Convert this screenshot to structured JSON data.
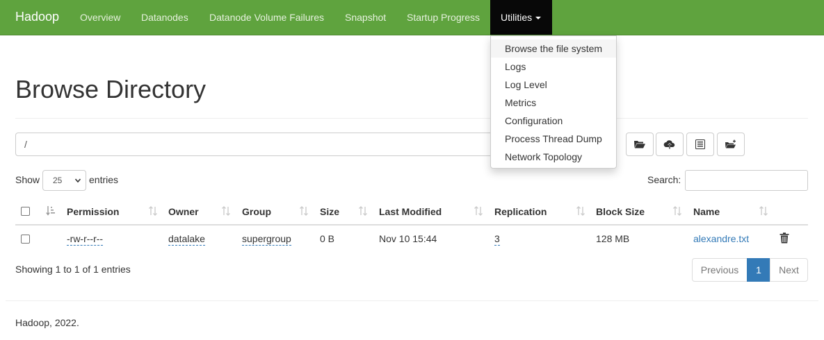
{
  "navbar": {
    "brand": "Hadoop",
    "items": [
      {
        "label": "Overview"
      },
      {
        "label": "Datanodes"
      },
      {
        "label": "Datanode Volume Failures"
      },
      {
        "label": "Snapshot"
      },
      {
        "label": "Startup Progress"
      },
      {
        "label": "Utilities"
      }
    ],
    "color": "#5fa33e"
  },
  "utilities_menu": {
    "items": [
      {
        "label": "Browse the file system"
      },
      {
        "label": "Logs"
      },
      {
        "label": "Log Level"
      },
      {
        "label": "Metrics"
      },
      {
        "label": "Configuration"
      },
      {
        "label": "Process Thread Dump"
      },
      {
        "label": "Network Topology"
      }
    ]
  },
  "page": {
    "title": "Browse Directory",
    "path_value": "/"
  },
  "toolbar": {
    "icons": [
      "folder-open-icon",
      "cloud-upload-icon",
      "list-alt-icon",
      "new-folder-icon"
    ]
  },
  "table_controls": {
    "show_label": "Show",
    "page_size": "25",
    "entries_label": "entries",
    "search_label": "Search:",
    "search_value": ""
  },
  "table": {
    "columns": [
      "Permission",
      "Owner",
      "Group",
      "Size",
      "Last Modified",
      "Replication",
      "Block Size",
      "Name"
    ],
    "rows": [
      {
        "permission": "-rw-r--r--",
        "owner": "datalake",
        "group": "supergroup",
        "size": "0 B",
        "last_modified": "Nov 10 15:44",
        "replication": "3",
        "block_size": "128 MB",
        "name": "alexandre.txt"
      }
    ]
  },
  "pagination": {
    "summary": "Showing 1 to 1 of 1 entries",
    "previous": "Previous",
    "current": "1",
    "next": "Next"
  },
  "footer": {
    "text": "Hadoop, 2022."
  }
}
